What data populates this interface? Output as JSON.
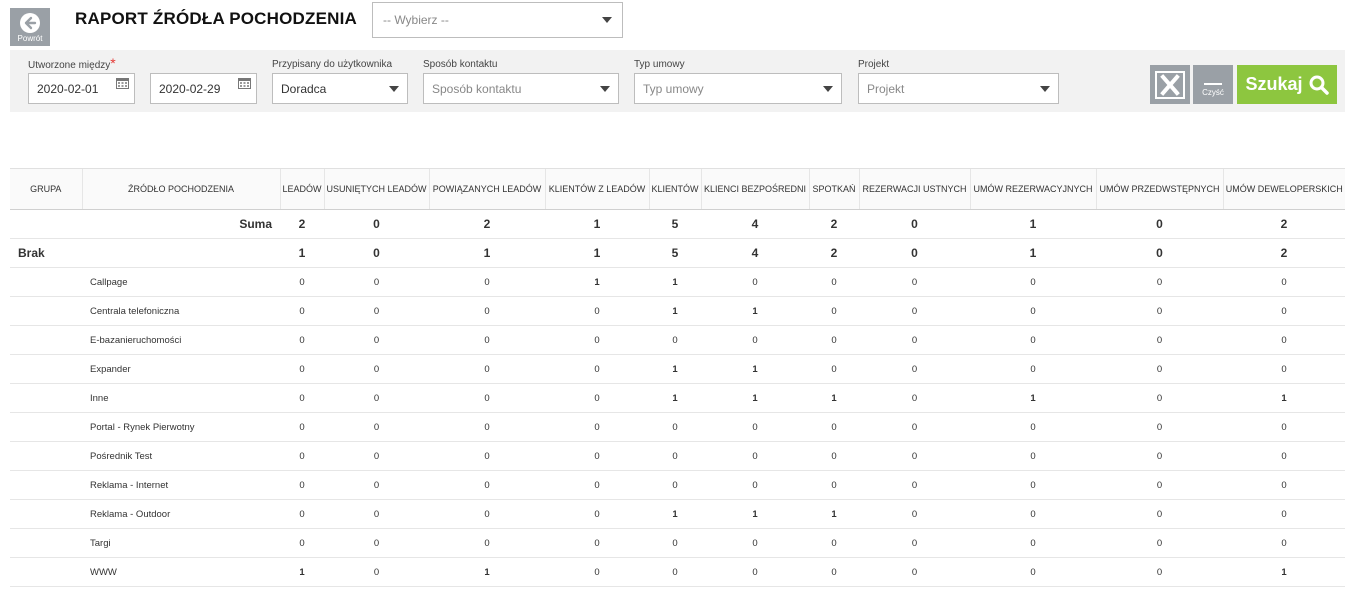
{
  "header": {
    "back_label": "Powrót",
    "title": "RAPORT ŹRÓDŁA POCHODZENIA",
    "select_placeholder": "-- Wybierz --"
  },
  "filters": {
    "created_between_label": "Utworzone między",
    "required_mark": "*",
    "date_from": "2020-02-01",
    "date_to": "2020-02-29",
    "assigned_label": "Przypisany do użytkownika",
    "assigned_value": "Doradca",
    "contact_label": "Sposób kontaktu",
    "contact_value": "Sposób kontaktu",
    "contract_label": "Typ umowy",
    "contract_value": "Typ umowy",
    "project_label": "Projekt",
    "project_value": "Projekt",
    "clear_label": "Czyść",
    "search_label": "Szukaj"
  },
  "table": {
    "columns": [
      "GRUPA",
      "ŹRÓDŁO POCHODZENIA",
      "LEADÓW",
      "USUNIĘTYCH LEADÓW",
      "POWIĄZANYCH LEADÓW",
      "KLIENTÓW Z LEADÓW",
      "KLIENTÓW",
      "KLIENCI BEZPOŚREDNI",
      "SPOTKAŃ",
      "REZERWACJI USTNYCH",
      "UMÓW REZERWACYJNYCH",
      "UMÓW PRZEDWSTĘPNYCH",
      "UMÓW DEWELOPERSKICH"
    ],
    "sum_label": "Suma",
    "sum_values": [
      "2",
      "0",
      "2",
      "1",
      "5",
      "4",
      "2",
      "0",
      "1",
      "0",
      "2"
    ],
    "group_name": "Brak",
    "group_values": [
      "1",
      "0",
      "1",
      "1",
      "5",
      "4",
      "2",
      "0",
      "1",
      "0",
      "2"
    ],
    "rows": [
      {
        "source": "Callpage",
        "values": [
          "0",
          "0",
          "0",
          "1",
          "1",
          "0",
          "0",
          "0",
          "0",
          "0",
          "0"
        ]
      },
      {
        "source": "Centrala telefoniczna",
        "values": [
          "0",
          "0",
          "0",
          "0",
          "1",
          "1",
          "0",
          "0",
          "0",
          "0",
          "0"
        ]
      },
      {
        "source": "E-bazanieruchomości",
        "values": [
          "0",
          "0",
          "0",
          "0",
          "0",
          "0",
          "0",
          "0",
          "0",
          "0",
          "0"
        ]
      },
      {
        "source": "Expander",
        "values": [
          "0",
          "0",
          "0",
          "0",
          "1",
          "1",
          "0",
          "0",
          "0",
          "0",
          "0"
        ]
      },
      {
        "source": "Inne",
        "values": [
          "0",
          "0",
          "0",
          "0",
          "1",
          "1",
          "1",
          "0",
          "1",
          "0",
          "1"
        ]
      },
      {
        "source": "Portal - Rynek Pierwotny",
        "values": [
          "0",
          "0",
          "0",
          "0",
          "0",
          "0",
          "0",
          "0",
          "0",
          "0",
          "0"
        ]
      },
      {
        "source": "Pośrednik Test",
        "values": [
          "0",
          "0",
          "0",
          "0",
          "0",
          "0",
          "0",
          "0",
          "0",
          "0",
          "0"
        ]
      },
      {
        "source": "Reklama - Internet",
        "values": [
          "0",
          "0",
          "0",
          "0",
          "0",
          "0",
          "0",
          "0",
          "0",
          "0",
          "0"
        ]
      },
      {
        "source": "Reklama - Outdoor",
        "values": [
          "0",
          "0",
          "0",
          "0",
          "1",
          "1",
          "1",
          "0",
          "0",
          "0",
          "0"
        ]
      },
      {
        "source": "Targi",
        "values": [
          "0",
          "0",
          "0",
          "0",
          "0",
          "0",
          "0",
          "0",
          "0",
          "0",
          "0"
        ]
      },
      {
        "source": "WWW",
        "values": [
          "1",
          "0",
          "1",
          "0",
          "0",
          "0",
          "0",
          "0",
          "0",
          "0",
          "1"
        ]
      }
    ]
  }
}
